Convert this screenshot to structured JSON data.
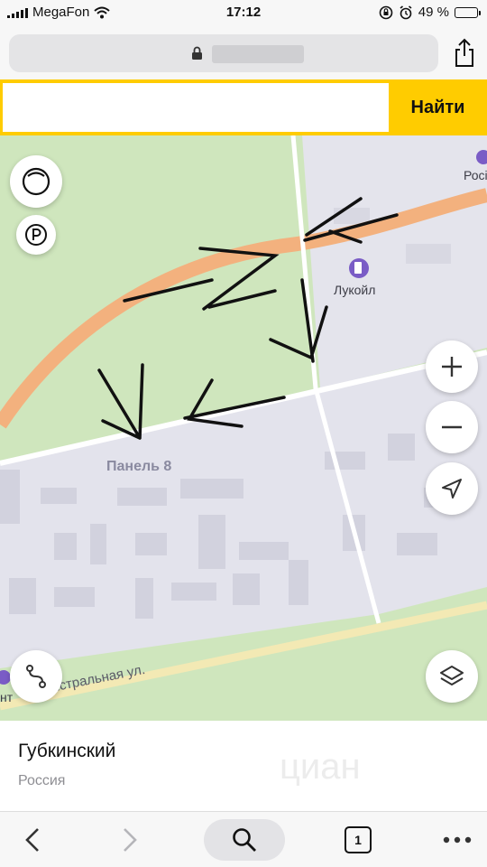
{
  "status_bar": {
    "carrier": "MegaFon",
    "time": "17:12",
    "battery": "49 %",
    "battery_level": 0.49,
    "icons": [
      "signal-icon",
      "wifi-icon",
      "orientation-lock-icon",
      "alarm-icon",
      "battery-icon"
    ]
  },
  "browser": {
    "url_icon": "lock-icon",
    "share_icon": "share-icon"
  },
  "search": {
    "value": "",
    "button_label": "Найти"
  },
  "map": {
    "labels": {
      "lukoil": "Лукойл",
      "panel": "Панель 8",
      "street": "Магистральная ул.",
      "edge_top": "Росі",
      "edge_bottom": "нт"
    },
    "controls": [
      "traffic-icon",
      "parking-icon",
      "zoom-in-icon",
      "zoom-out-icon",
      "locate-icon",
      "route-icon",
      "layers-icon"
    ],
    "colors": {
      "green": "#cfe6bd",
      "urban": "#e3e3ec",
      "highway": "#f3b17e",
      "road": "#ffffff",
      "poi": "#7a5cc6"
    }
  },
  "place": {
    "title": "Губкинский",
    "subtitle": "Россия",
    "watermark": "циан"
  },
  "toolbar": {
    "tabs_count": "1",
    "icons": [
      "back-icon",
      "forward-icon",
      "search-icon",
      "tabs-icon",
      "more-icon"
    ]
  }
}
